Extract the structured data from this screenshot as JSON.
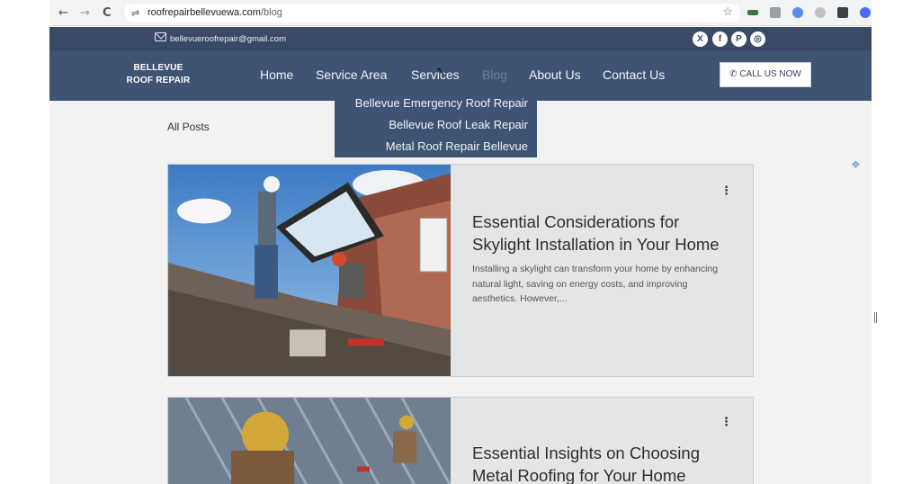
{
  "browser": {
    "back": "←",
    "forward": "→",
    "reload": "C",
    "url_domain": "roofrepairbellevuewa.com",
    "url_path": "/blog",
    "star": "☆"
  },
  "topbar": {
    "email": "bellevueroofrepair@gmail.com",
    "social": [
      "X",
      "f",
      "P",
      "◎"
    ]
  },
  "navbar": {
    "logo_line1": "BELLEVUE",
    "logo_line2": "ROOF REPAIR",
    "links": [
      "Home",
      "Service Area",
      "Services",
      "Blog",
      "About Us",
      "Contact Us"
    ],
    "call_button": "CALL US NOW"
  },
  "dropdown": {
    "items": [
      "Bellevue Emergency Roof Repair",
      "Bellevue Roof Leak Repair",
      "Metal Roof Repair Bellevue"
    ]
  },
  "main": {
    "heading": "All Posts",
    "posts": [
      {
        "title": "Essential Considerations for Skylight Installation in Your Home",
        "excerpt": "Installing a skylight can transform your home by enhancing natural light, saving on energy costs, and improving aesthetics. However,..."
      },
      {
        "title": "Essential Insights on Choosing Metal Roofing for Your Home",
        "excerpt": ""
      }
    ],
    "more_icon": "⋮"
  },
  "colors": {
    "header_top": "#3a4a66",
    "header_nav": "#3f5373",
    "page_bg": "#f2f2f3",
    "card_bg": "#e4e5e6"
  }
}
